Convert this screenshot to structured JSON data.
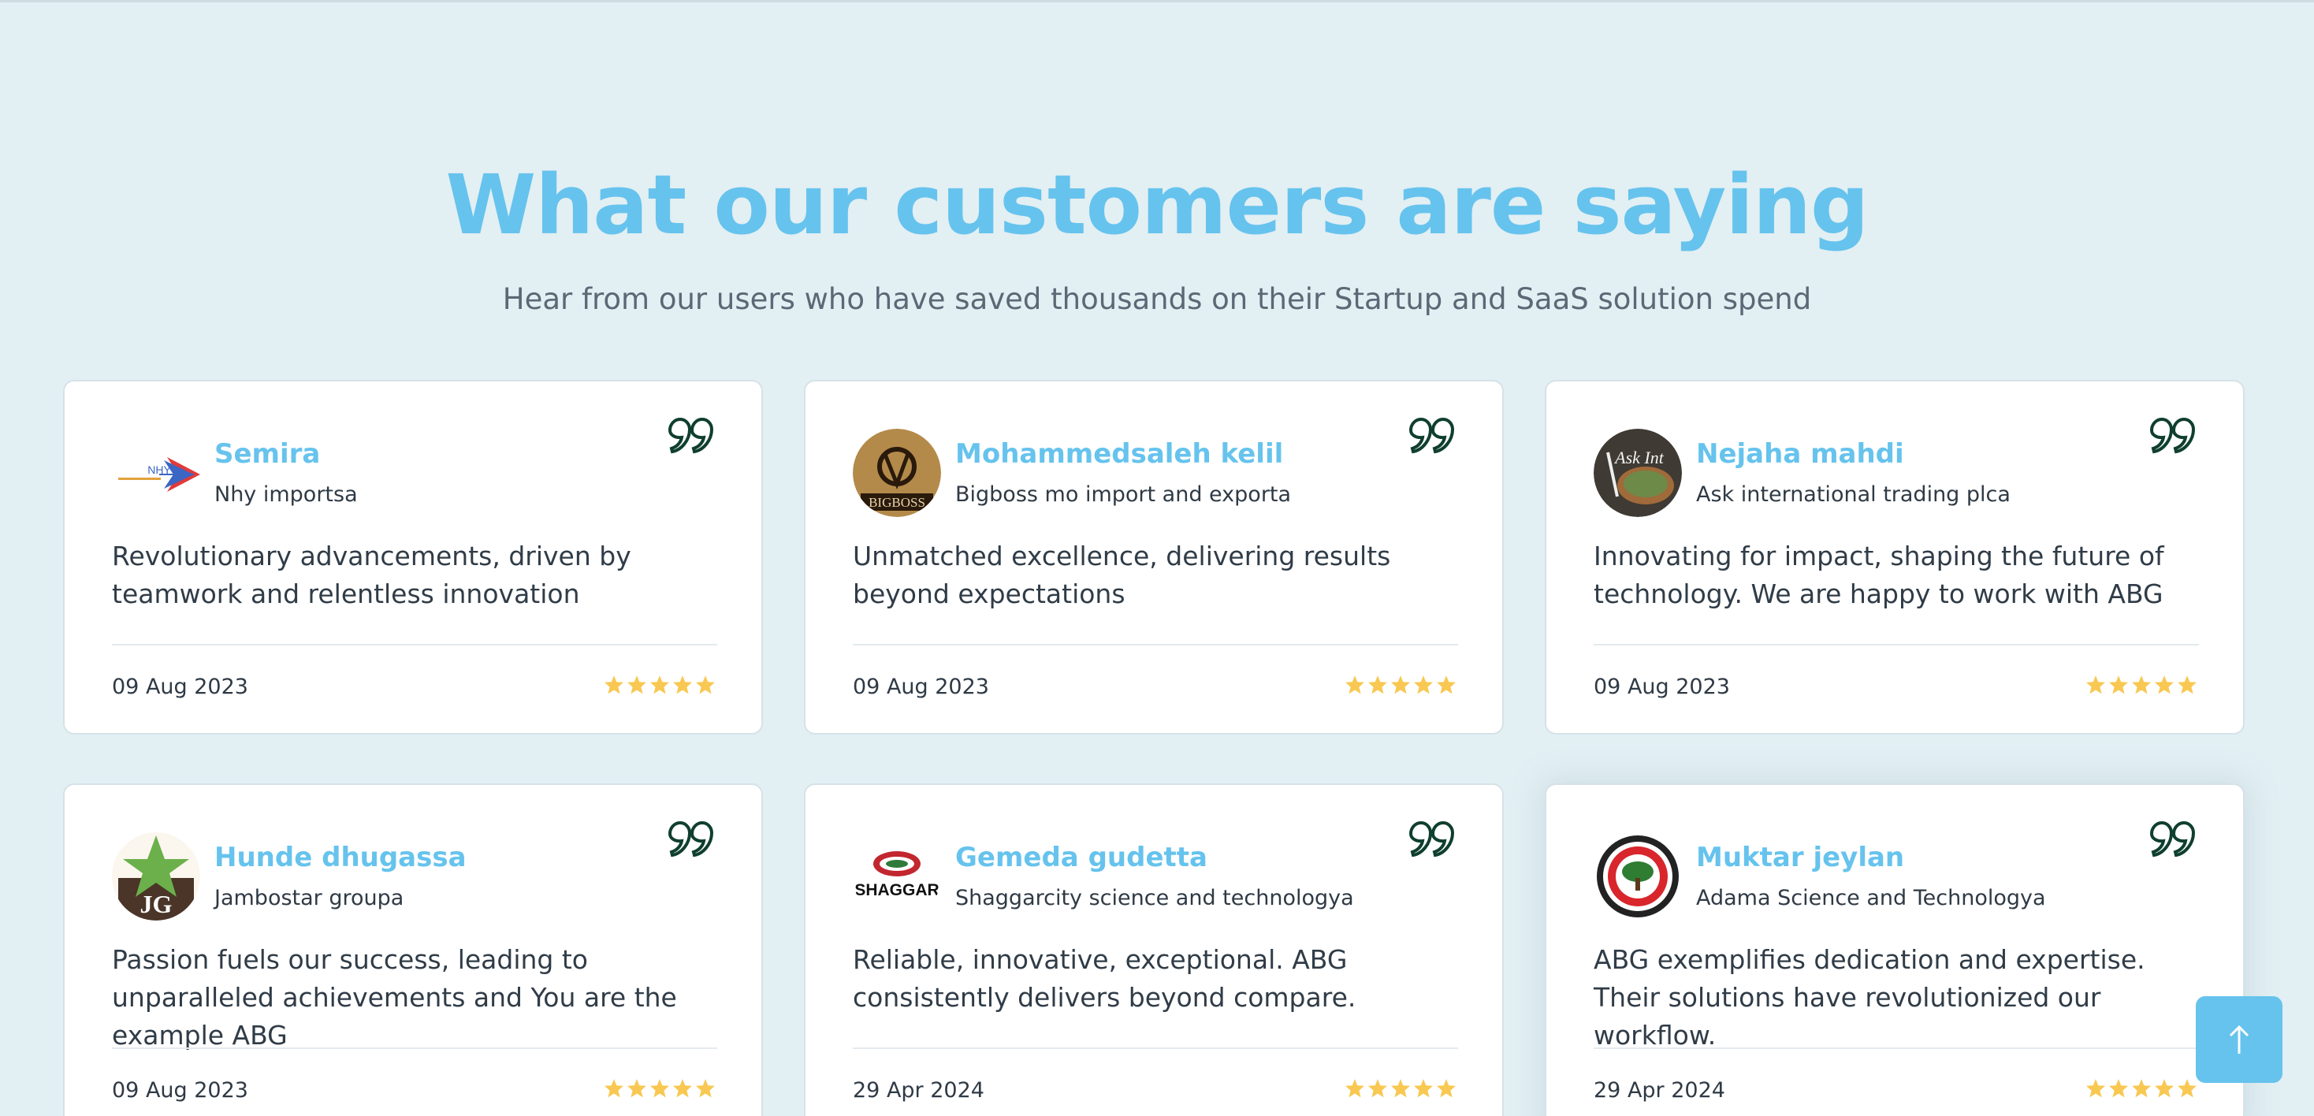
{
  "header": {
    "title": "What our customers are saying",
    "subtitle": "Hear from our users who have saved thousands on their Startup and SaaS solution spend"
  },
  "colors": {
    "accent": "#66c3ed",
    "star": "#f8c852",
    "background": "#e2eff3"
  },
  "testimonials": [
    {
      "name": "Semira",
      "company": "Nhy importsa",
      "avatar": "nhy-logo",
      "avatar_text": "NHY",
      "quote": "Revolutionary advancements, driven by teamwork and relentless innovation",
      "date": "09 Aug 2023",
      "rating": 5
    },
    {
      "name": "Mohammedsaleh kelil",
      "company": "Bigboss mo import and exporta",
      "avatar": "bigboss-logo",
      "avatar_text": "BIGBOSS",
      "quote": "Unmatched excellence, delivering results beyond expectations",
      "date": "09 Aug 2023",
      "rating": 5
    },
    {
      "name": "Nejaha mahdi",
      "company": "Ask international trading plca",
      "avatar": "ask-int-logo",
      "avatar_text": "Ask Int",
      "quote": "Innovating for impact, shaping the future of technology.  We are happy to work with ABG",
      "date": "09 Aug 2023",
      "rating": 5
    },
    {
      "name": "Hunde dhugassa",
      "company": "Jambostar groupa",
      "avatar": "jambostar-logo",
      "avatar_text": "JG",
      "quote": "Passion fuels our success, leading to unparalleled achievements and You are the example ABG",
      "date": "09 Aug 2023",
      "rating": 5
    },
    {
      "name": "Gemeda gudetta",
      "company": "Shaggarcity science and technologya",
      "avatar": "shaggar-logo",
      "avatar_text": "SHAGGAR",
      "quote": "Reliable, innovative, exceptional. ABG consistently delivers beyond compare.",
      "date": "29 Apr 2024",
      "rating": 5
    },
    {
      "name": "Muktar jeylan",
      "company": "Adama Science and Technologya",
      "avatar": "adama-logo",
      "avatar_text": "",
      "quote": "ABG exemplifies dedication and expertise. Their solutions have revolutionized our workflow.",
      "date": "29 Apr 2024",
      "rating": 5
    }
  ],
  "scroll_top": {
    "icon": "arrow-up-icon"
  }
}
